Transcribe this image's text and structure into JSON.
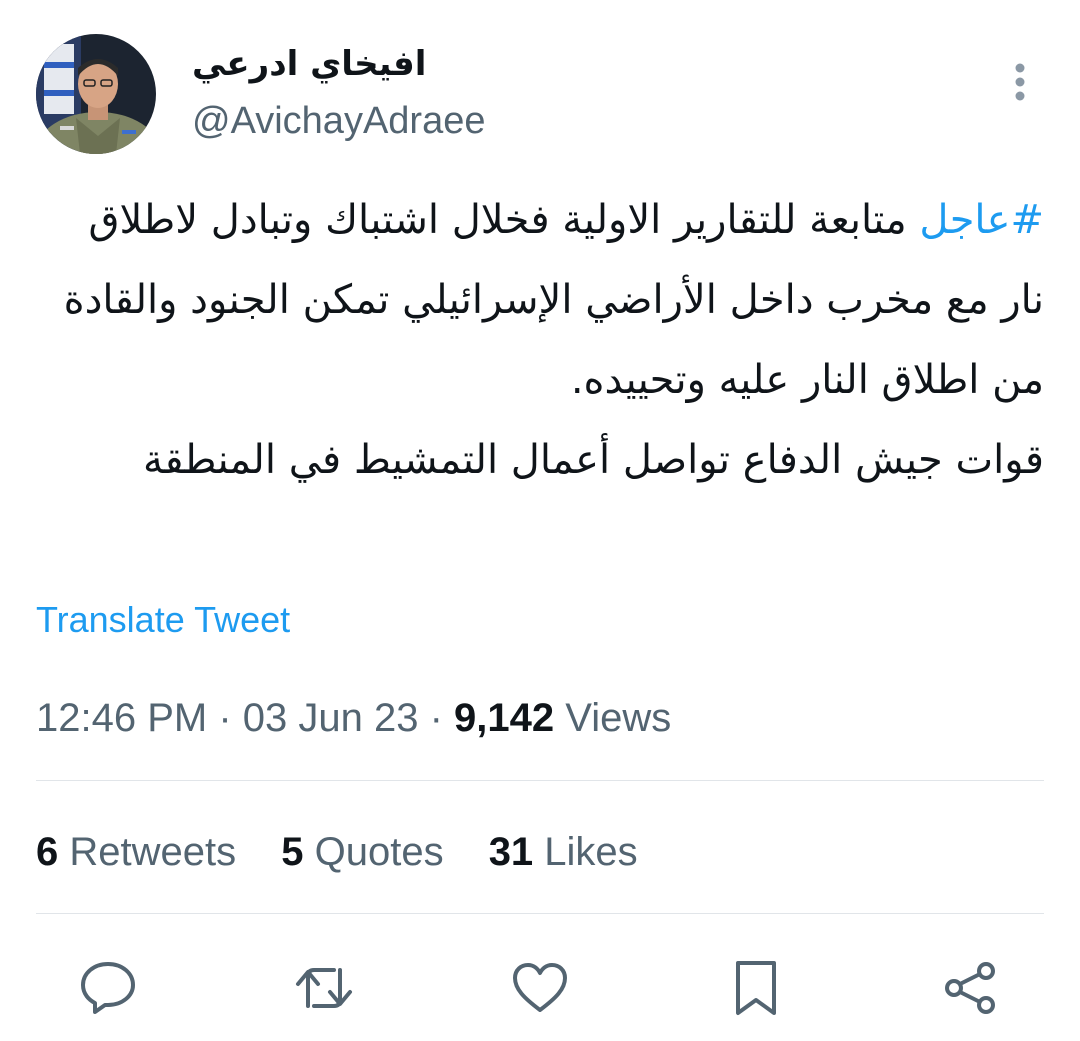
{
  "author": {
    "display_name": "افيخاي ادرعي",
    "handle": "@AvichayAdraee"
  },
  "tweet": {
    "hashtag": "#عاجل",
    "line1_rest": " متابعة للتقارير الاولية فخلال اشتباك وتبادل لاطلاق نار مع مخرب داخل الأراضي الإسرائيلي تمكن الجنود والقادة من اطلاق النار عليه وتحييده.",
    "line2": "قوات جيش الدفاع تواصل أعمال التمشيط في المنطقة"
  },
  "translate_label": "Translate Tweet",
  "meta": {
    "time": "12:46 PM",
    "separator": " · ",
    "date": "03 Jun 23",
    "views_count": "9,142",
    "views_label": " Views"
  },
  "stats": {
    "retweets_count": "6",
    "retweets_label": " Retweets",
    "quotes_count": "5",
    "quotes_label": " Quotes",
    "likes_count": "31",
    "likes_label": " Likes"
  },
  "colors": {
    "accent": "#1d9bf0",
    "secondary_text": "#536471",
    "primary_text": "#0f1419",
    "divider": "#e1e5e9"
  },
  "icons": [
    "more-vertical-icon",
    "reply-icon",
    "retweet-icon",
    "like-icon",
    "bookmark-icon",
    "share-icon"
  ]
}
